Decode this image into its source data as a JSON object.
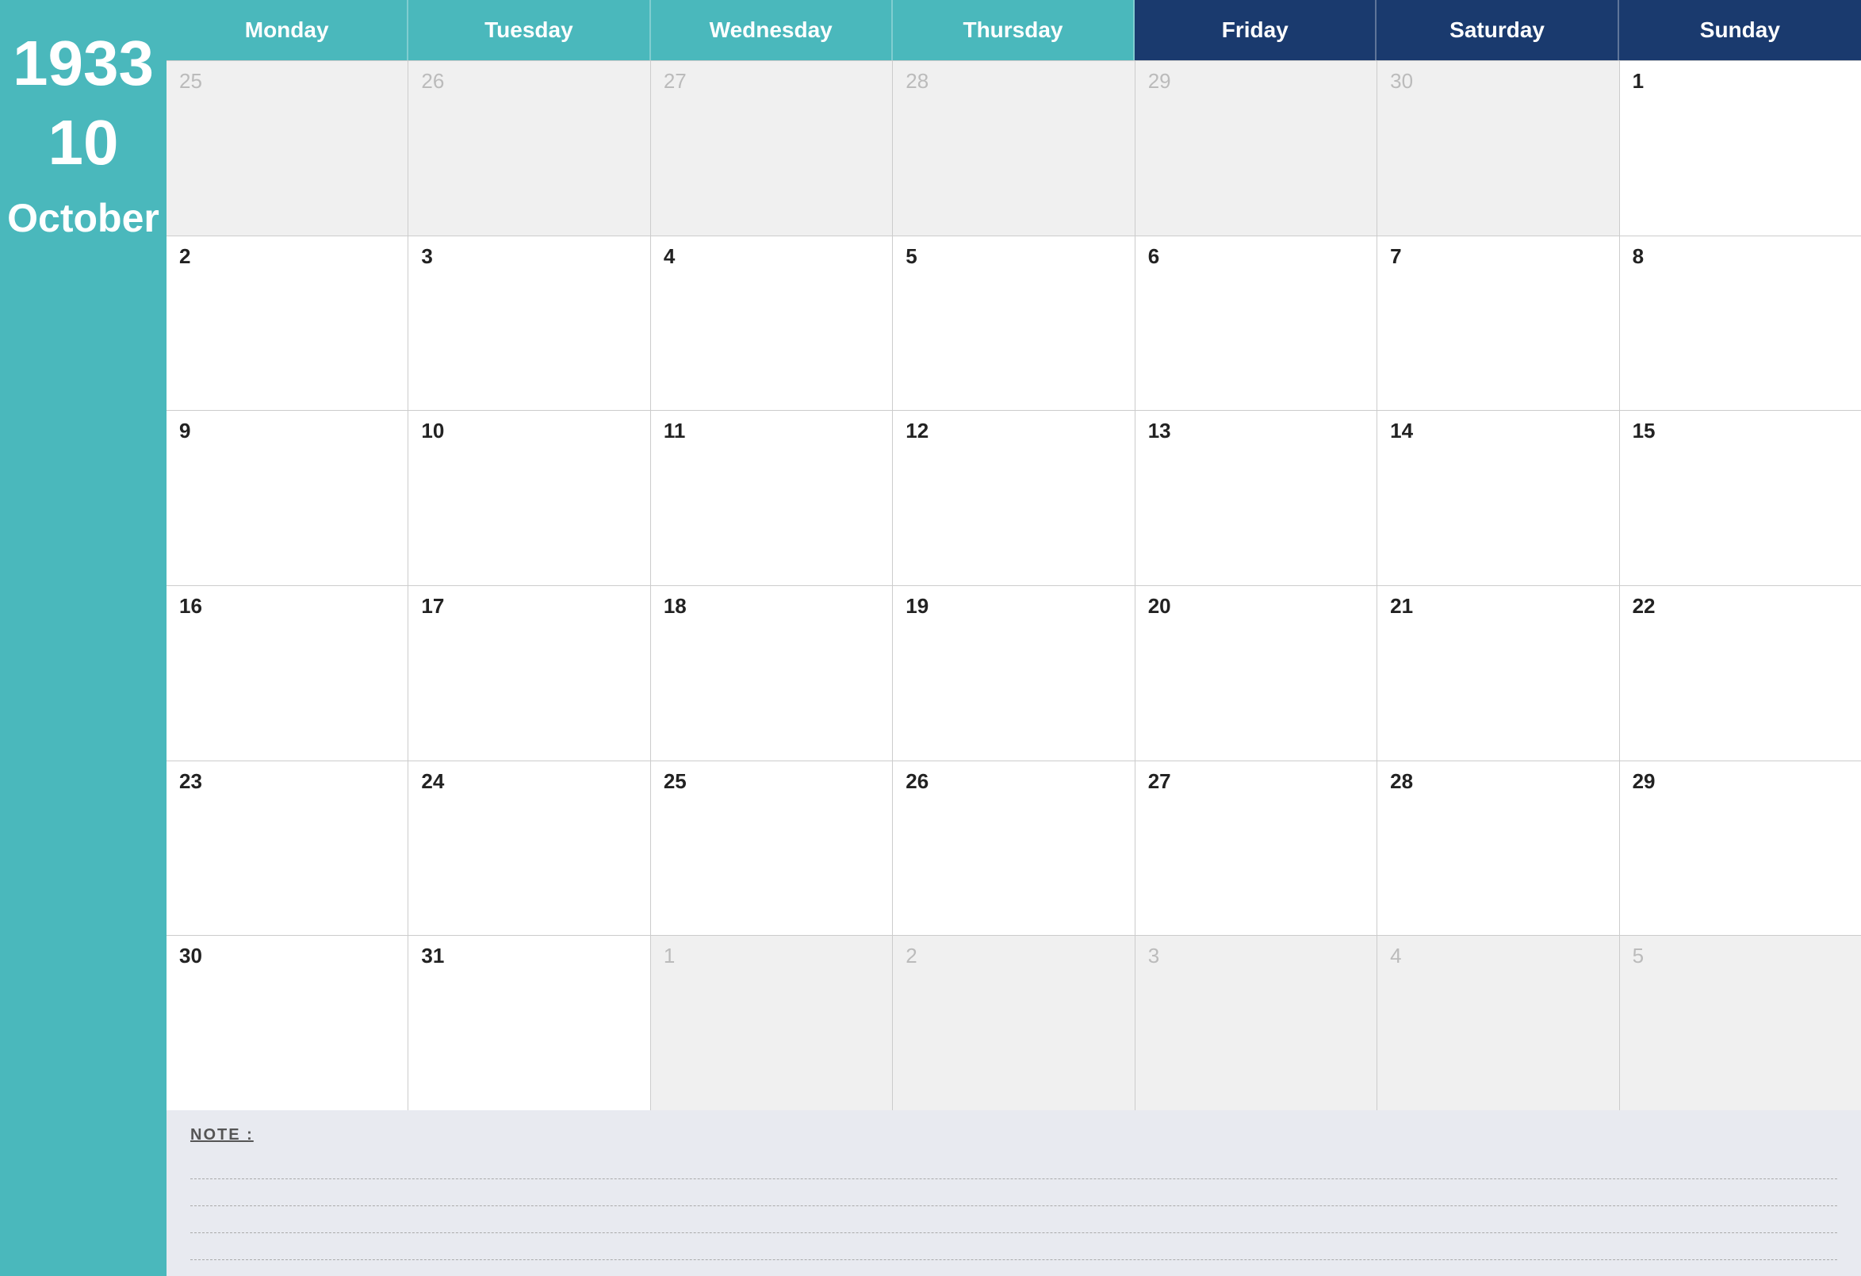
{
  "sidebar": {
    "year": "1933",
    "month_num": "10",
    "month_name": "October"
  },
  "header": {
    "days": [
      "Monday",
      "Tuesday",
      "Wednesday",
      "Thursday",
      "Friday",
      "Saturday",
      "Sunday"
    ]
  },
  "weeks": [
    [
      {
        "num": "25",
        "type": "other"
      },
      {
        "num": "26",
        "type": "other"
      },
      {
        "num": "27",
        "type": "other"
      },
      {
        "num": "28",
        "type": "other"
      },
      {
        "num": "29",
        "type": "other"
      },
      {
        "num": "30",
        "type": "other"
      },
      {
        "num": "1",
        "type": "current"
      }
    ],
    [
      {
        "num": "2",
        "type": "current"
      },
      {
        "num": "3",
        "type": "current"
      },
      {
        "num": "4",
        "type": "current"
      },
      {
        "num": "5",
        "type": "current"
      },
      {
        "num": "6",
        "type": "current"
      },
      {
        "num": "7",
        "type": "current"
      },
      {
        "num": "8",
        "type": "current"
      }
    ],
    [
      {
        "num": "9",
        "type": "current"
      },
      {
        "num": "10",
        "type": "current"
      },
      {
        "num": "11",
        "type": "current"
      },
      {
        "num": "12",
        "type": "current"
      },
      {
        "num": "13",
        "type": "current"
      },
      {
        "num": "14",
        "type": "current"
      },
      {
        "num": "15",
        "type": "current"
      }
    ],
    [
      {
        "num": "16",
        "type": "current"
      },
      {
        "num": "17",
        "type": "current"
      },
      {
        "num": "18",
        "type": "current"
      },
      {
        "num": "19",
        "type": "current"
      },
      {
        "num": "20",
        "type": "current"
      },
      {
        "num": "21",
        "type": "current"
      },
      {
        "num": "22",
        "type": "current"
      }
    ],
    [
      {
        "num": "23",
        "type": "current"
      },
      {
        "num": "24",
        "type": "current"
      },
      {
        "num": "25",
        "type": "current"
      },
      {
        "num": "26",
        "type": "current"
      },
      {
        "num": "27",
        "type": "current"
      },
      {
        "num": "28",
        "type": "current"
      },
      {
        "num": "29",
        "type": "current"
      }
    ],
    [
      {
        "num": "30",
        "type": "current"
      },
      {
        "num": "31",
        "type": "current"
      },
      {
        "num": "1",
        "type": "other"
      },
      {
        "num": "2",
        "type": "other"
      },
      {
        "num": "3",
        "type": "other"
      },
      {
        "num": "4",
        "type": "other"
      },
      {
        "num": "5",
        "type": "other"
      }
    ]
  ],
  "notes": {
    "label": "NOTE :",
    "lines": 4
  }
}
